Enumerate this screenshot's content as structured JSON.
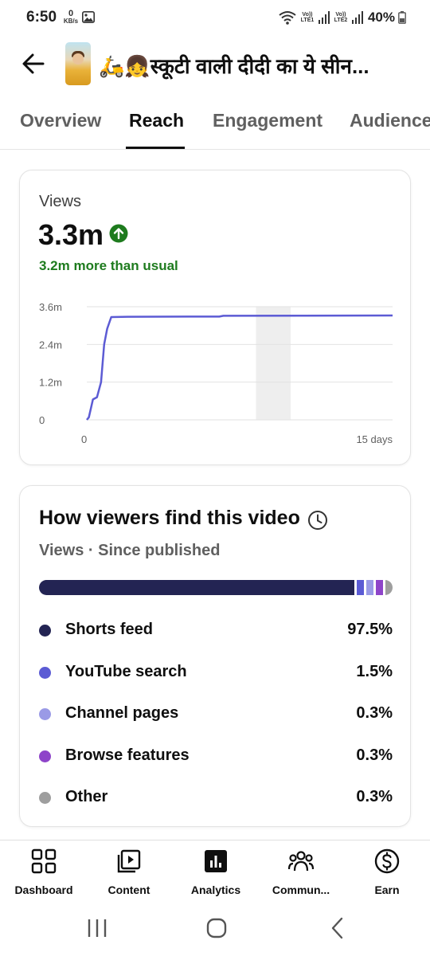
{
  "status_bar": {
    "time": "6:50",
    "net_speed_value": "0",
    "net_speed_unit": "KB/s",
    "sim1_label": "Vo)) LTE1",
    "sim2_label": "Vo)) LTE2",
    "battery": "40%"
  },
  "header": {
    "title": "🛵👧स्कूटी वाली दीदी का ये सीन..."
  },
  "tabs": [
    {
      "label": "Overview"
    },
    {
      "label": "Reach"
    },
    {
      "label": "Engagement"
    },
    {
      "label": "Audience"
    }
  ],
  "active_tab": "Reach",
  "views_card": {
    "label": "Views",
    "value": "3.3m",
    "trend_icon": "arrow-up-circle-icon",
    "delta_text": "3.2m more than usual",
    "delta_color": "#1e7b1e"
  },
  "chart_data": {
    "type": "line",
    "x_ticks": [
      "0",
      "15 days"
    ],
    "y_ticks": [
      "0",
      "1.2m",
      "2.4m",
      "3.6m"
    ],
    "ylim": [
      0,
      3600000
    ],
    "xlim": [
      0,
      15
    ],
    "grid": true,
    "highlight_range": [
      8.3,
      10
    ],
    "series": [
      {
        "color": "#5c5bd4",
        "points": [
          [
            0,
            0
          ],
          [
            0.1,
            80000
          ],
          [
            0.3,
            650000
          ],
          [
            0.5,
            720000
          ],
          [
            0.7,
            1200000
          ],
          [
            0.85,
            2400000
          ],
          [
            1.0,
            2900000
          ],
          [
            1.2,
            3270000
          ],
          [
            2.0,
            3280000
          ],
          [
            5.0,
            3285000
          ],
          [
            6.5,
            3285000
          ],
          [
            6.7,
            3310000
          ],
          [
            15,
            3320000
          ]
        ]
      }
    ]
  },
  "traffic_sources": {
    "title": "How viewers find this video",
    "subtitle": "Views · Since published",
    "items": [
      {
        "name": "Shorts feed",
        "percent": "97.5%",
        "value": 97.5,
        "color": "#232453"
      },
      {
        "name": "YouTube search",
        "percent": "1.5%",
        "value": 1.5,
        "color": "#5b5bd4"
      },
      {
        "name": "Channel pages",
        "percent": "0.3%",
        "value": 0.3,
        "color": "#9a9ae6"
      },
      {
        "name": "Browse features",
        "percent": "0.3%",
        "value": 0.3,
        "color": "#8e44c9"
      },
      {
        "name": "Other",
        "percent": "0.3%",
        "value": 0.3,
        "color": "#9e9e9e"
      }
    ]
  },
  "bottom_nav": [
    {
      "label": "Dashboard",
      "icon": "dashboard-icon"
    },
    {
      "label": "Content",
      "icon": "content-icon"
    },
    {
      "label": "Analytics",
      "icon": "analytics-icon"
    },
    {
      "label": "Commun...",
      "icon": "community-icon"
    },
    {
      "label": "Earn",
      "icon": "earn-icon"
    }
  ]
}
